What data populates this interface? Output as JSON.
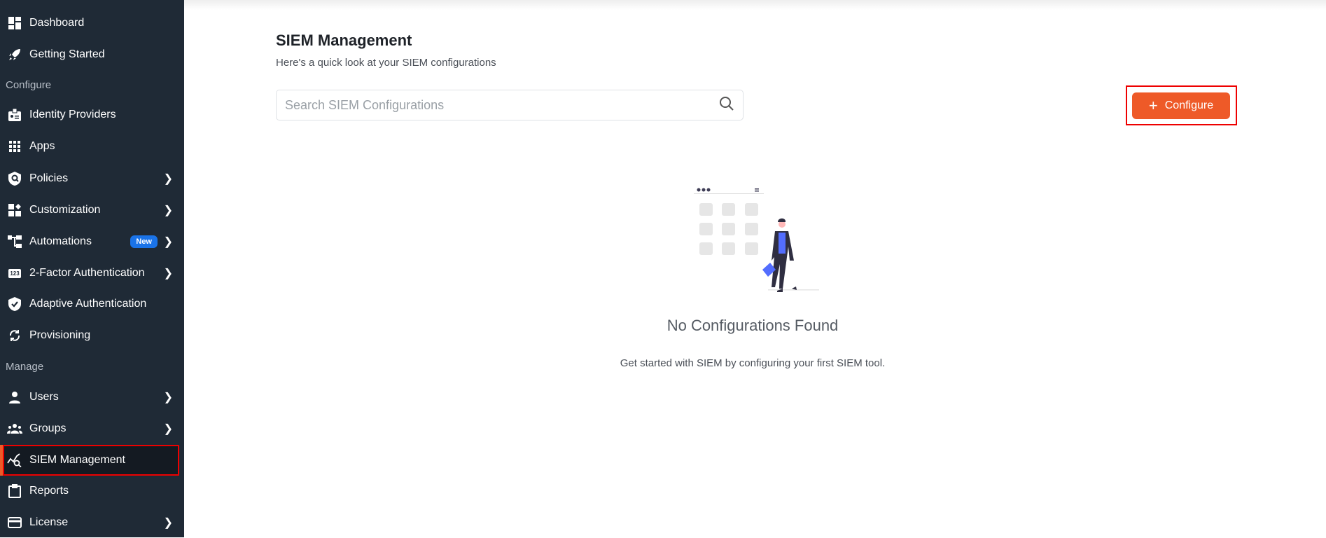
{
  "sidebar": {
    "items": [
      {
        "label": "Dashboard",
        "icon": "dashboard-icon"
      },
      {
        "label": "Getting Started",
        "icon": "rocket-icon"
      },
      {
        "label": "Identity Providers",
        "icon": "id-badge-icon"
      },
      {
        "label": "Apps",
        "icon": "grid-icon"
      },
      {
        "label": "Policies",
        "icon": "shield-search-icon"
      },
      {
        "label": "Customization",
        "icon": "widgets-icon"
      },
      {
        "label": "Automations",
        "icon": "flow-icon",
        "badge": "New"
      },
      {
        "label": "2-Factor Authentication",
        "icon": "123-icon",
        "badge_icon": "123"
      },
      {
        "label": "Adaptive Authentication",
        "icon": "shield-check-icon"
      },
      {
        "label": "Provisioning",
        "icon": "sync-icon"
      },
      {
        "label": "Users",
        "icon": "user-icon"
      },
      {
        "label": "Groups",
        "icon": "groups-icon"
      },
      {
        "label": "SIEM Management",
        "icon": "siem-icon"
      },
      {
        "label": "Reports",
        "icon": "clipboard-icon"
      },
      {
        "label": "License",
        "icon": "card-icon"
      }
    ],
    "sections": {
      "configure": "Configure",
      "manage": "Manage"
    }
  },
  "main": {
    "title": "SIEM Management",
    "subtitle": "Here's a quick look at your SIEM configurations",
    "search_placeholder": "Search SIEM Configurations",
    "configure_label": "Configure",
    "empty_title": "No Configurations Found",
    "empty_sub": "Get started with SIEM by configuring your first SIEM tool."
  },
  "colors": {
    "accent": "#ee5a28",
    "sidebar": "#1f2a36",
    "badge": "#1a73e8"
  }
}
